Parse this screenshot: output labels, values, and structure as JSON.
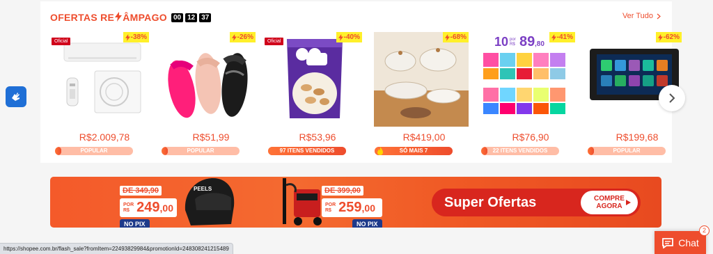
{
  "flash": {
    "title_start": "OFERTAS RE",
    "title_end": "ÂMPAGO",
    "timer": [
      "00",
      "12",
      "37"
    ],
    "see_all": "Ver Tudo"
  },
  "products": [
    {
      "discount": "-38%",
      "official": "Oficial",
      "price": "R$2.009,78",
      "bar_label": "POPULAR",
      "progress": 0.08,
      "image": "air-conditioner"
    },
    {
      "discount": "-26%",
      "official": "",
      "price": "R$51,99",
      "bar_label": "POPULAR",
      "progress": 0.08,
      "image": "sandals"
    },
    {
      "discount": "-40%",
      "official": "Oficial",
      "price": "R$53,96",
      "bar_label": "97 ITENS VENDIDOS",
      "progress": 1.0,
      "image": "cashew-bag"
    },
    {
      "discount": "-68%",
      "official": "",
      "price": "R$419,00",
      "bar_label": "SÓ MAIS 7",
      "progress": 1.0,
      "image": "cookware"
    },
    {
      "discount": "-41%",
      "official": "",
      "price": "R$76,90",
      "bar_label": "22 ITENS VENDIDOS",
      "progress": 0.08,
      "image": "kids-clothes"
    },
    {
      "discount": "-62%",
      "official": "",
      "price": "R$199,68",
      "bar_label": "POPULAR",
      "progress": 0.08,
      "image": "car-stereo"
    }
  ],
  "product5_overlay": {
    "qty": "10",
    "por": "por",
    "rs": "R$",
    "price": "89",
    "cents": ",80"
  },
  "banner": {
    "offer1": {
      "old": "DE 349,90",
      "por": "POR",
      "rs": "R$",
      "price": "249",
      "cents": ",00",
      "pix": "NO PIX"
    },
    "offer2": {
      "old": "DE 399,00",
      "por": "POR",
      "rs": "R$",
      "price": "259",
      "cents": ",00",
      "pix": "NO PIX"
    },
    "super": "Super Ofertas",
    "cta_line1": "COMPRE",
    "cta_line2": "AGORA",
    "helmet_brand": "PEELS"
  },
  "chat": {
    "label": "Chat",
    "badge": "2"
  },
  "status_url": "https://shopee.com.br/flash_sale?fromItem=22493829984&promotionId=248308241215489",
  "colors": {
    "accent": "#ee4d2d",
    "discount_bg": "#fff02a",
    "pix": "#1e3a8a"
  }
}
